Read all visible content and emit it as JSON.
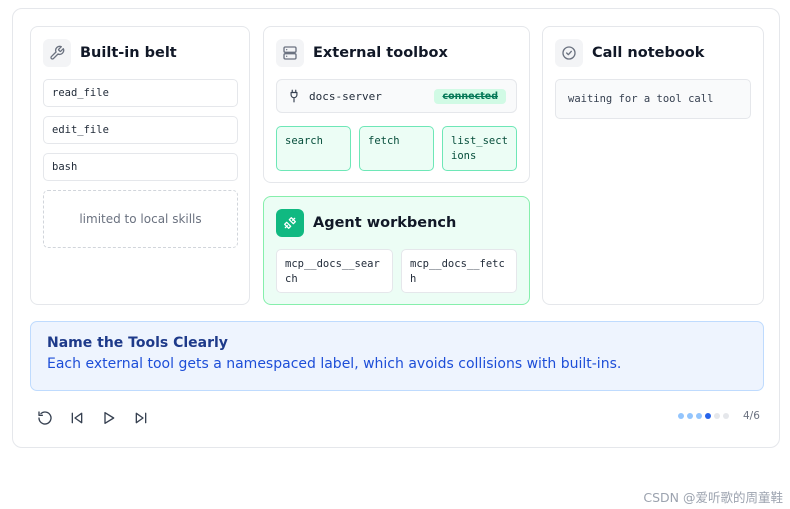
{
  "builtin": {
    "title": "Built-in belt",
    "tools": [
      "read_file",
      "edit_file",
      "bash"
    ],
    "note": "limited to local skills"
  },
  "external": {
    "title": "External toolbox",
    "server_name": "docs-server",
    "server_status": "connected",
    "tools": [
      "search",
      "fetch",
      "list_sections"
    ]
  },
  "workbench": {
    "title": "Agent workbench",
    "tools": [
      "mcp__docs__search",
      "mcp__docs__fetch"
    ]
  },
  "notebook": {
    "title": "Call notebook",
    "status": "waiting for a tool call"
  },
  "callout": {
    "title": "Name the Tools Clearly",
    "text": "Each external tool gets a namespaced label, which avoids collisions with built-ins."
  },
  "controls": {
    "icons": [
      "restart-icon",
      "previous-icon",
      "play-icon",
      "next-icon"
    ]
  },
  "progress": {
    "current": 4,
    "total": 6,
    "label": "4/6",
    "colors": {
      "done": "#93c5fd",
      "active": "#2563eb",
      "pending": "#e5e7eb"
    }
  },
  "watermark": "CSDN @爱听歌的周童鞋",
  "colors": {
    "accent_green": "#10b981",
    "chip_border": "#6ee7b7",
    "callout_bg": "#eef4fe",
    "callout_title": "#1e3a8a"
  }
}
